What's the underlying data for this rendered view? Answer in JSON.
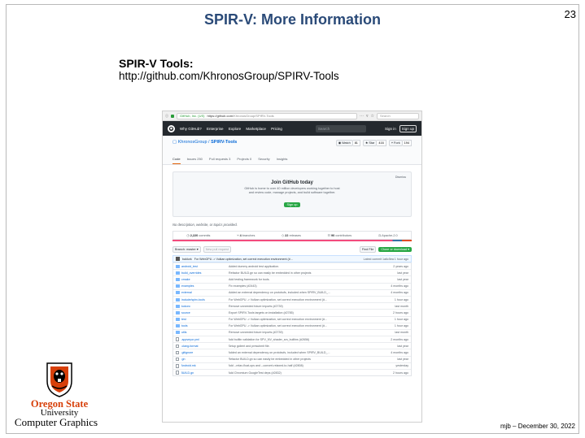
{
  "slide": {
    "title": "SPIR-V: More Information",
    "number": "23",
    "heading": "SPIR-V Tools:",
    "url": "http://github.com/KhronosGroup/SPIRV-Tools",
    "footer": "mjb – December 30, 2022"
  },
  "logo": {
    "line1": "Oregon State",
    "line2": "University",
    "line3": "Computer Graphics"
  },
  "browser": {
    "org_badge": "GitHub, Inc. (US)",
    "url_host": "https://github.com",
    "url_path": "/KhronosGroup/SPIRV-Tools",
    "search_placeholder": "Search"
  },
  "github": {
    "nav": [
      "Why GitHub?",
      "Enterprise",
      "Explore",
      "Marketplace",
      "Pricing"
    ],
    "search_placeholder": "Search",
    "sign_in": "Sign in",
    "sign_up": "Sign up",
    "repo_owner": "KhronosGroup",
    "repo_name": "SPIRV-Tools",
    "watch_label": "Watch",
    "watch_count": "81",
    "star_label": "Star",
    "star_count": "416",
    "fork_label": "Fork",
    "fork_count": "194",
    "tabs": [
      "Code",
      "Issues 250",
      "Pull requests 3",
      "Projects 0",
      "Security",
      "Insights"
    ],
    "join": {
      "dismiss": "Dismiss",
      "title": "Join GitHub today",
      "body": "GitHub is home to over 40 million developers working together to host and review code, manage projects, and build software together.",
      "button": "Sign up"
    },
    "description": "No description, website, or topics provided.",
    "stats": {
      "commits": "2,220",
      "commits_label": "commits",
      "branches": "4",
      "branches_label": "branches",
      "releases": "22",
      "releases_label": "releases",
      "contributors": "90",
      "contributors_label": "contributors",
      "license": "Apache-2.0"
    },
    "branch": "Branch: master ▾",
    "new_pr": "New pull request",
    "find_file": "Find File",
    "clone": "Clone or download ▾",
    "latest_commit": {
      "author": "baldurk",
      "message": "For WebGPU -> Vulkan optimization, set correct execution environment (#...",
      "latest": "Latest commit 1a6c5ea 1 hour ago"
    },
    "files": [
      {
        "type": "dir",
        "name": "android_test",
        "message": "Added dummy android test application.",
        "age": "2 years ago"
      },
      {
        "type": "dir",
        "name": "build_overrides",
        "message": "Refactor BUILD.gn so can easily be embedded in other projects",
        "age": "last year"
      },
      {
        "type": "dir",
        "name": "cmake",
        "message": "Add testing framework for tools.",
        "age": "last year"
      },
      {
        "type": "dir",
        "name": "examples",
        "message": "Fix examples (#2443)",
        "age": "4 months ago"
      },
      {
        "type": "dir",
        "name": "external",
        "message": "Added an external dependency on protobufs, included when SPIRV_BUILD_...",
        "age": "4 months ago"
      },
      {
        "type": "dir",
        "name": "include/spirv-tools",
        "message": "For WebGPU -> Vulkan optimization, set correct execution environment (#...",
        "age": "1 hour ago"
      },
      {
        "type": "dir",
        "name": "kokoro",
        "message": "Remove unneeded future imports (#2739)",
        "age": "last month"
      },
      {
        "type": "dir",
        "name": "source",
        "message": "Export SPIRV-Tools targets on installation (#2785)",
        "age": "2 hours ago"
      },
      {
        "type": "dir",
        "name": "test",
        "message": "For WebGPU -> Vulkan optimization, set correct execution environment (#...",
        "age": "1 hour ago"
      },
      {
        "type": "dir",
        "name": "tools",
        "message": "For WebGPU -> Vulkan optimization, set correct execution environment (#...",
        "age": "1 hour ago"
      },
      {
        "type": "dir",
        "name": "utils",
        "message": "Remove unneeded future imports (#2739)",
        "age": "last month"
      },
      {
        "type": "file",
        "name": ".appveyor.yml",
        "message": "Add builtin validation for SPV_NV_shader_sm_builtins (#2656)",
        "age": "2 months ago"
      },
      {
        "type": "file",
        "name": ".clang-format",
        "message": "Setup gclient and presubmit file.",
        "age": "last year"
      },
      {
        "type": "file",
        "name": ".gitignore",
        "message": "Added an external dependency on protobufs, included when SPIRV_BUILD_...",
        "age": "4 months ago"
      },
      {
        "type": "file",
        "name": ".gn",
        "message": "Refactor BUILD.gn so can easily be embedded in other projects",
        "age": "last year"
      },
      {
        "type": "file",
        "name": "Android.mk",
        "message": "Add --relax-float-ops and --convert-relaxed-to-half (#2808)",
        "age": "yesterday"
      },
      {
        "type": "file",
        "name": "BUILD.gn",
        "message": "Add Chromium GoogleTest deps (#2832)",
        "age": "2 hours ago"
      }
    ]
  }
}
